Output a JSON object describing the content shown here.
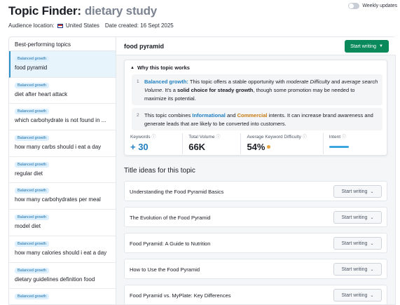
{
  "header": {
    "title": "Topic Finder:",
    "subtitle": "dietary study",
    "audience_label": "Audience location:",
    "audience_value": "United States",
    "date_label": "Date created: 16 Sept 2025",
    "weekly_updates_label": "Weekly updates"
  },
  "left_panel": {
    "heading": "Best-performing topics",
    "items": [
      {
        "badge": "Balanced growth",
        "label": "food pyramid"
      },
      {
        "badge": "Balanced growth",
        "label": "diet after heart attack"
      },
      {
        "badge": "Balanced growth",
        "label": "which carbohydrate is not found in ..."
      },
      {
        "badge": "Balanced growth",
        "label": "how many carbs should i eat a day"
      },
      {
        "badge": "Balanced growth",
        "label": "regular diet"
      },
      {
        "badge": "Balanced growth",
        "label": "how many carbohydrates per meal"
      },
      {
        "badge": "Balanced growth",
        "label": "model diet"
      },
      {
        "badge": "Balanced growth",
        "label": "how many calories should i eat a day"
      },
      {
        "badge": "Balanced growth",
        "label": "dietary guidelines definition food"
      },
      {
        "badge": "Balanced growth",
        "label": ""
      }
    ]
  },
  "main": {
    "topic_title": "food pyramid",
    "start_writing_label": "Start writing",
    "why_heading": "Why this topic works",
    "reason1": {
      "num": "1",
      "p1": "Balanced growth:",
      "p2": " This topic offers a stable opportunity with ",
      "p3": "moderate Difficulty",
      "p4": " and ",
      "p5": "average search Volume",
      "p6": ". It's a ",
      "p7": "solid choice for steady growth",
      "p8": ", though some promotion may be needed to maximize its potential."
    },
    "reason2": {
      "num": "2",
      "p1": "This topic combines ",
      "p2": "Informational",
      "p3": " and ",
      "p4": "Commercial",
      "p5": " intents. It can increase brand awareness and generate leads that are likely to be converted into customers."
    },
    "metrics": {
      "keywords_label": "Keywords",
      "keywords_value": "+ 30",
      "volume_label": "Total Volume",
      "volume_value": "66K",
      "difficulty_label": "Average Keyword Difficulty",
      "difficulty_value": "54%",
      "intent_label": "Intent"
    },
    "ideas_heading": "Title ideas for this topic",
    "ideas": [
      {
        "title": "Understanding the Food Pyramid Basics",
        "button": "Start writing"
      },
      {
        "title": "The Evolution of the Food Pyramid",
        "button": "Start writing"
      },
      {
        "title": "Food Pyramid: A Guide to Nutrition",
        "button": "Start writing"
      },
      {
        "title": "How to Use the Food Pyramid",
        "button": "Start writing"
      },
      {
        "title": "Food Pyramid vs. MyPlate: Key Differences",
        "button": "Start writing"
      }
    ]
  },
  "colors": {
    "accent_green": "#0a8a5a",
    "highlight_blue": "#1f7fc0",
    "highlight_orange": "#c57a12",
    "difficulty_dot": "#e8a33b"
  }
}
